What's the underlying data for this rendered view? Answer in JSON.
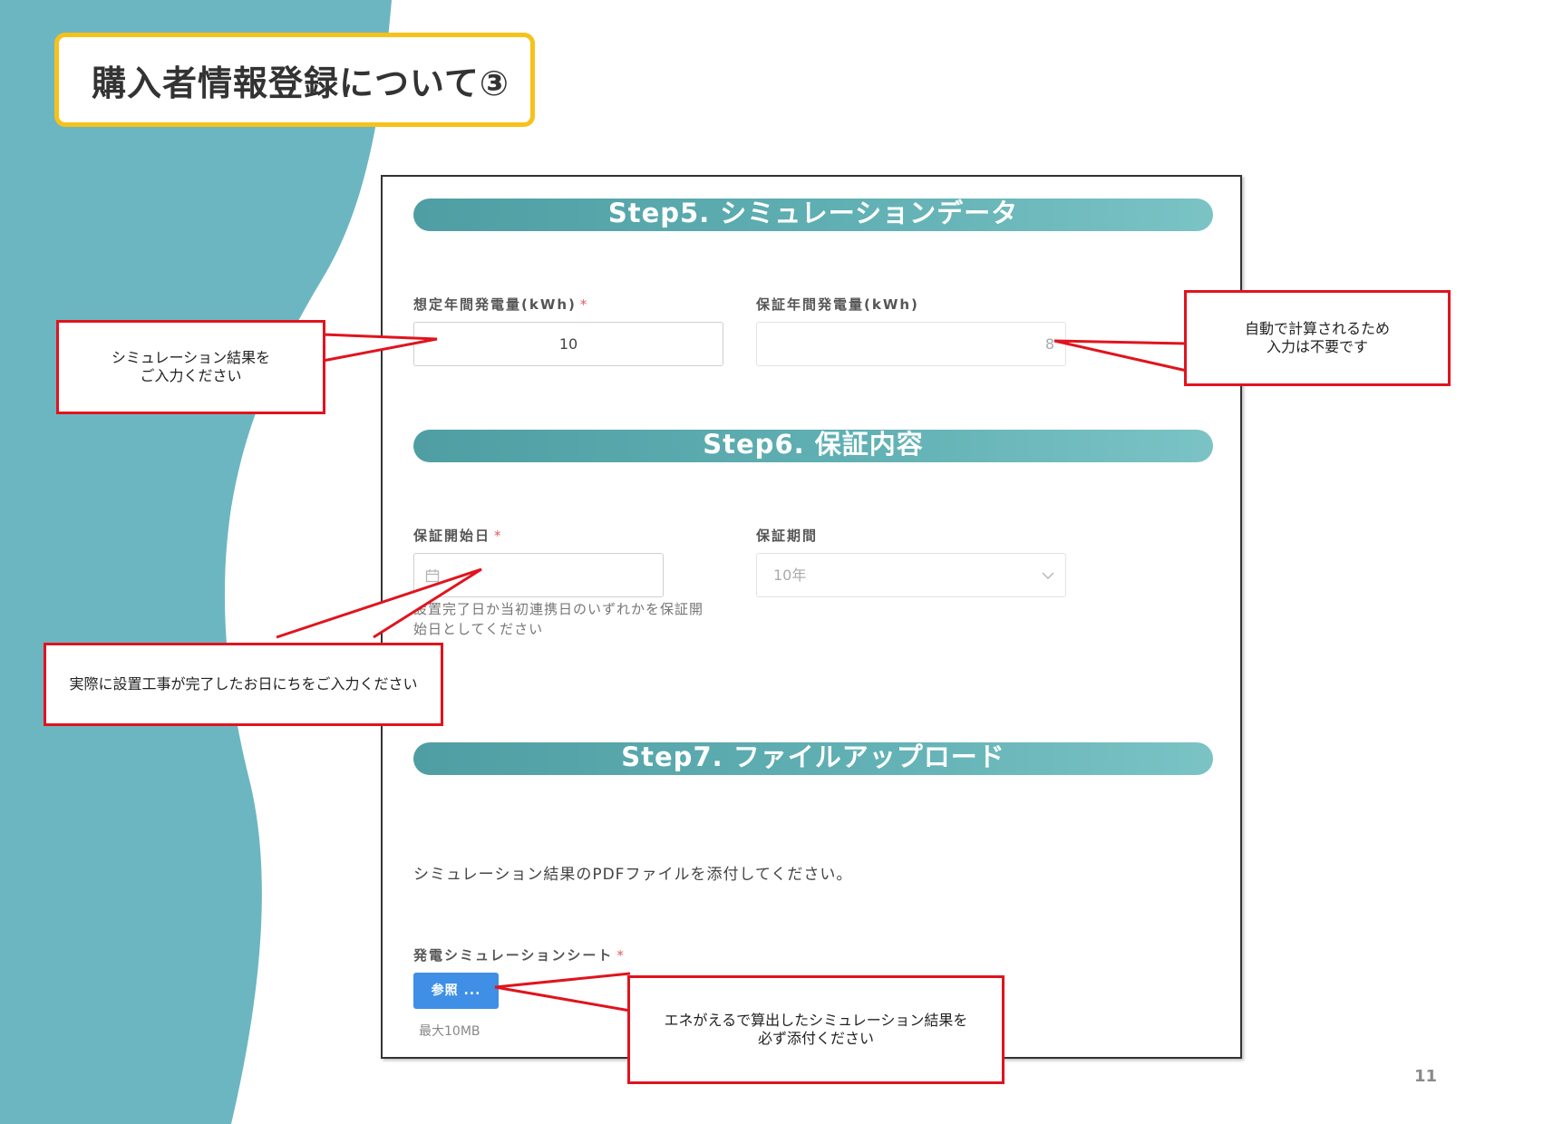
{
  "slide": {
    "title": "購入者情報登録について③",
    "page_number": "11",
    "colors": {
      "wave": "#6cb6c2",
      "title_border": "#f6c21a",
      "callout_border": "#e0141e",
      "step_bar": "#5eaeb2",
      "browse_button": "#3f8fe6"
    }
  },
  "form": {
    "step5": {
      "title": "Step5. シミュレーションデータ",
      "expected_label": "想定年間発電量(kWh)",
      "expected_required": "*",
      "expected_value": "10",
      "guaranteed_label": "保証年間発電量(kWh)",
      "guaranteed_value": "8"
    },
    "step6": {
      "title": "Step6. 保証内容",
      "start_label": "保証開始日",
      "start_required": "*",
      "start_help_line1": "設置完了日か当初連携日のいずれかを保証開",
      "start_help_line2": "始日としてください",
      "calendar_icon": "calendar-icon",
      "period_label": "保証期間",
      "period_value": "10年",
      "chevron_icon": "chevron-down-icon"
    },
    "step7": {
      "title": "Step7. ファイルアップロード",
      "instruction": "シミュレーション結果のPDFファイルを添付してください。",
      "sheet_label": "発電シミュレーションシート",
      "sheet_required": "*",
      "browse_label": "参照 ...",
      "max_size": "最大10MB"
    }
  },
  "callouts": {
    "simulation": {
      "line1": "シミュレーション結果を",
      "line2": "ご入力ください"
    },
    "auto_calc": {
      "line1": "自動で計算されるため",
      "line2": "入力は不要です"
    },
    "install_date": {
      "line1": "実際に設置工事が完了したお日にちをご入力ください"
    },
    "attach": {
      "line1": "エネがえるで算出したシミュレーション結果を",
      "line2": "必ず添付ください"
    }
  }
}
